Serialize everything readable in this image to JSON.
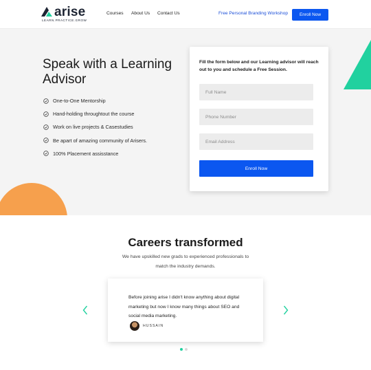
{
  "brand": {
    "name": "arise",
    "tagline": "LEARN.PRACTICE.GROW",
    "colors": {
      "primary": "#0b57f0",
      "accent_green": "#21d19f",
      "accent_orange": "#f6a04d",
      "dark": "#1d2433"
    }
  },
  "nav": {
    "items": [
      "Courses",
      "About Us",
      "Contact Us"
    ],
    "workshop_link": "Free Personal Branding Workshop",
    "enroll_label": "Enroll Now"
  },
  "hero": {
    "title": "Speak with a Learning Advisor",
    "features": [
      "One-to-One Mentorship",
      "Hand-holding throughtout the course",
      "Work on live projects & Casestudies",
      "Be apart of amazing community of Arisers.",
      "100% Placement assisstance"
    ],
    "feature_icon": "check-circle-icon"
  },
  "form": {
    "intro": "Fill the form below and our Learning advisor will reach out to you and schedule a Free Session.",
    "fields": {
      "name_placeholder": "Full Name",
      "phone_placeholder": "Phone Number",
      "email_placeholder": "Email Address"
    },
    "submit_label": "Enroll Now"
  },
  "careers": {
    "title": "Careers transformed",
    "subtitle": "We have upskilled new grads to experienced professionals to match the industry demands."
  },
  "testimonial": {
    "quote": "Before joining arise I didn't know anything about digital marketing but now I know many things about SEO and social media marketing.",
    "author": "HUSSAIN",
    "prev_icon": "chevron-left-icon",
    "next_icon": "chevron-right-icon"
  },
  "carousel": {
    "total": 2,
    "active": 1
  }
}
